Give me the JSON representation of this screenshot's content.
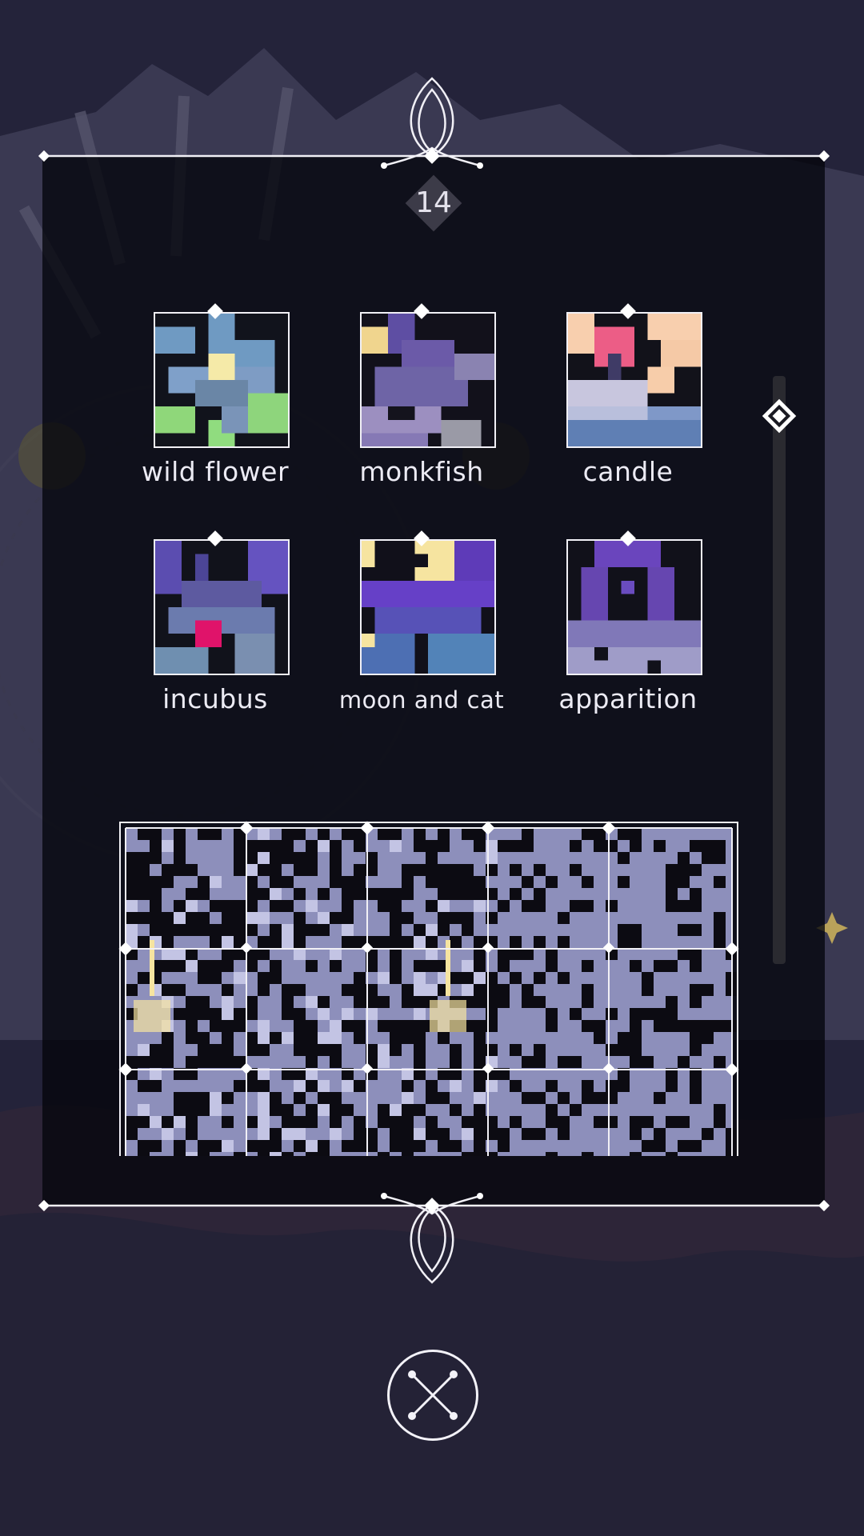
{
  "level": {
    "number": "14"
  },
  "puzzles": [
    {
      "id": "wild-flower",
      "label": "wild flower"
    },
    {
      "id": "monkfish",
      "label": "monkfish"
    },
    {
      "id": "candle",
      "label": "candle"
    },
    {
      "id": "incubus",
      "label": "incubus"
    },
    {
      "id": "moon-and-cat",
      "label": "moon and cat"
    },
    {
      "id": "apparition",
      "label": "apparition"
    }
  ],
  "preview_grid": {
    "columns": 5,
    "rows": 3
  },
  "colors": {
    "background": "#24233a",
    "panel": "#05060c",
    "frame": "#f1f0f6",
    "preview_tile": "#8d8fbb",
    "preview_dark": "#0c0b12",
    "accent_pink": "#e0136a",
    "accent_yellow": "#f6e4a0"
  },
  "icons": {
    "close": "close-x-icon",
    "scroll": "diamond-scroll-thumb-icon"
  }
}
